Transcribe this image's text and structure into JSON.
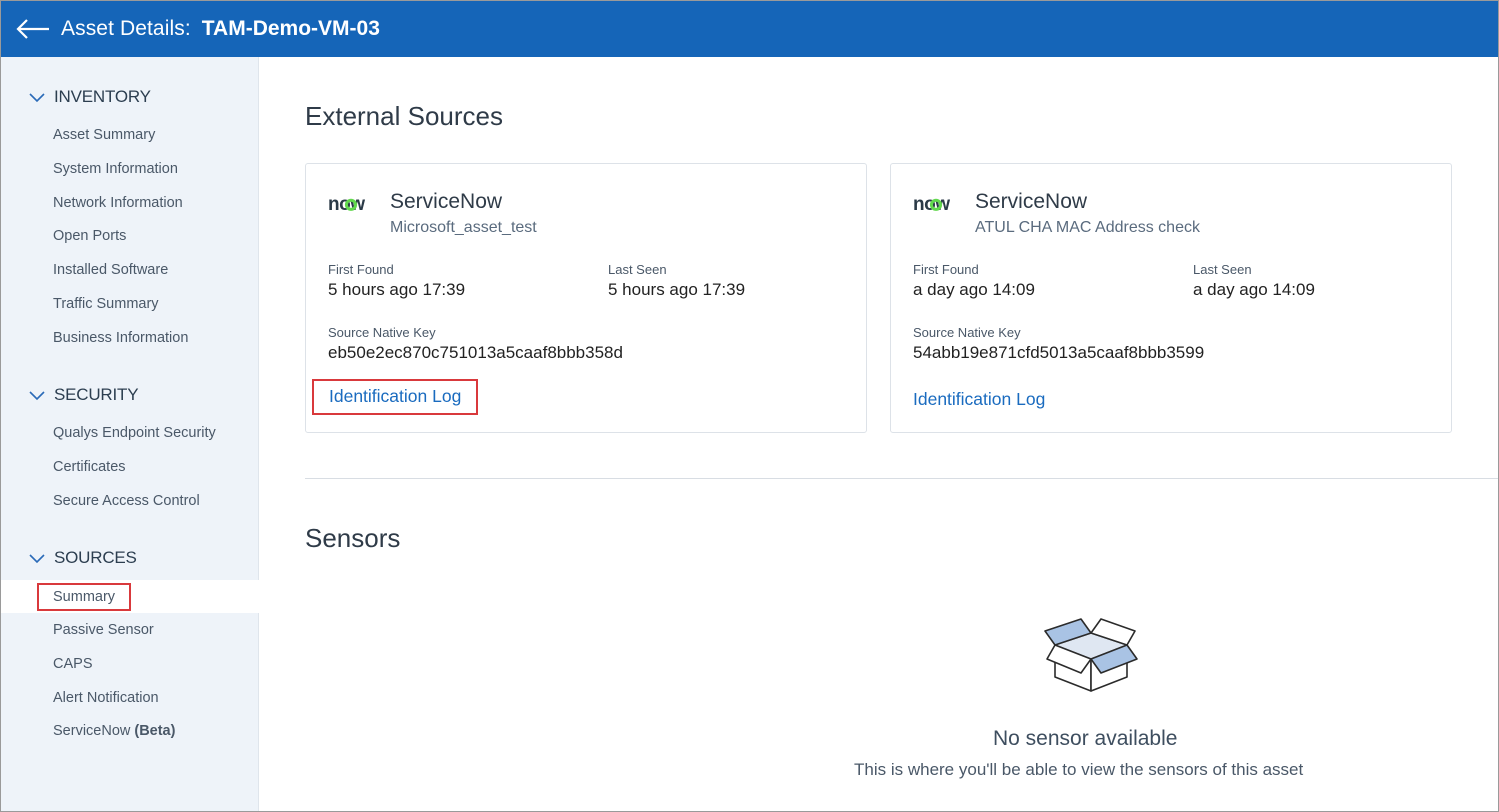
{
  "header": {
    "title_label": "Asset Details:",
    "asset_name": "TAM-Demo-VM-03",
    "back_icon": "arrow-left-icon"
  },
  "sidebar": {
    "sections": [
      {
        "heading": "INVENTORY",
        "items": [
          {
            "label": "Asset Summary"
          },
          {
            "label": "System Information"
          },
          {
            "label": "Network Information"
          },
          {
            "label": "Open Ports"
          },
          {
            "label": "Installed Software"
          },
          {
            "label": "Traffic Summary"
          },
          {
            "label": "Business Information"
          }
        ]
      },
      {
        "heading": "SECURITY",
        "items": [
          {
            "label": "Qualys Endpoint Security"
          },
          {
            "label": "Certificates"
          },
          {
            "label": "Secure Access Control"
          }
        ]
      },
      {
        "heading": "SOURCES",
        "items": [
          {
            "label": "Summary",
            "active": true
          },
          {
            "label": "Passive Sensor"
          },
          {
            "label": "CAPS"
          },
          {
            "label": "Alert Notification"
          },
          {
            "label": "ServiceNow",
            "suffix": "(Beta)"
          }
        ]
      }
    ]
  },
  "main": {
    "external_sources_title": "External Sources",
    "sources": [
      {
        "logo_text": "now",
        "name": "ServiceNow",
        "subtitle": "Microsoft_asset_test",
        "first_found_label": "First Found",
        "first_found_value": "5 hours ago 17:39",
        "last_seen_label": "Last Seen",
        "last_seen_value": "5 hours ago 17:39",
        "native_key_label": "Source Native Key",
        "native_key_value": "eb50e2ec870c751013a5caaf8bbb358d",
        "link_label": "Identification Log"
      },
      {
        "logo_text": "now",
        "name": "ServiceNow",
        "subtitle": "ATUL CHA MAC Address check",
        "first_found_label": "First Found",
        "first_found_value": "a day ago 14:09",
        "last_seen_label": "Last Seen",
        "last_seen_value": "a day ago 14:09",
        "native_key_label": "Source Native Key",
        "native_key_value": "54abb19e871cfd5013a5caaf8bbb3599",
        "link_label": "Identification Log"
      }
    ],
    "sensors_title": "Sensors",
    "empty_state": {
      "icon": "empty-box-icon",
      "title": "No sensor available",
      "subtitle": "This is where you'll be able to view the sensors of this asset"
    }
  },
  "colors": {
    "header_bg": "#1565b8",
    "sidebar_bg": "#eef3f9",
    "link": "#1a6bbf",
    "highlight_border": "#d9393c",
    "now_logo_green": "#62d84e"
  }
}
